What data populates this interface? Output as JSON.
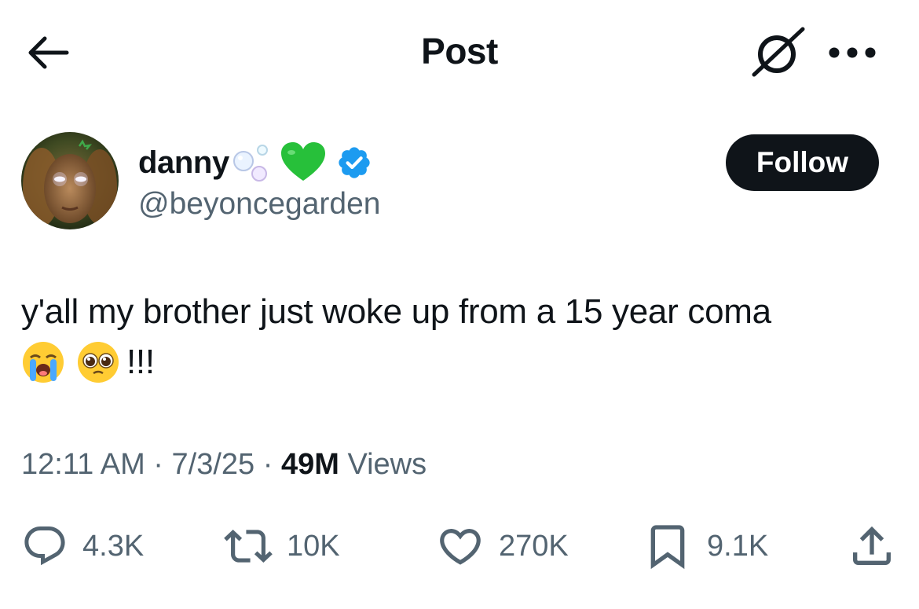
{
  "header": {
    "title": "Post",
    "icons": {
      "back": "arrow-left-icon",
      "grok": "grok-icon",
      "more": "more-horizontal-icon"
    }
  },
  "author": {
    "display_name": "danny",
    "name_emojis": [
      "bubbles-emoji",
      "green-heart-emoji"
    ],
    "verified_badge": "verified-badge-icon",
    "handle": "@beyoncegarden",
    "follow_label": "Follow"
  },
  "post": {
    "text_line1": "y'all my brother just woke up from a 15 year coma",
    "text_emojis": [
      "loudly-crying-face-emoji",
      "pleading-face-emoji"
    ],
    "text_suffix": "!!!"
  },
  "meta": {
    "time": "12:11 AM",
    "separator": "·",
    "date": "7/3/25",
    "views_count": "49M",
    "views_label": "Views"
  },
  "actions": {
    "replies": "4.3K",
    "reposts": "10K",
    "likes": "270K",
    "bookmarks": "9.1K",
    "icons": [
      "reply-icon",
      "repost-icon",
      "like-icon",
      "bookmark-icon",
      "share-icon"
    ]
  },
  "colors": {
    "text_primary": "#0f1419",
    "text_secondary": "#536471",
    "verified_blue": "#1d9bf0",
    "follow_bg": "#0f1419",
    "background": "#ffffff"
  }
}
